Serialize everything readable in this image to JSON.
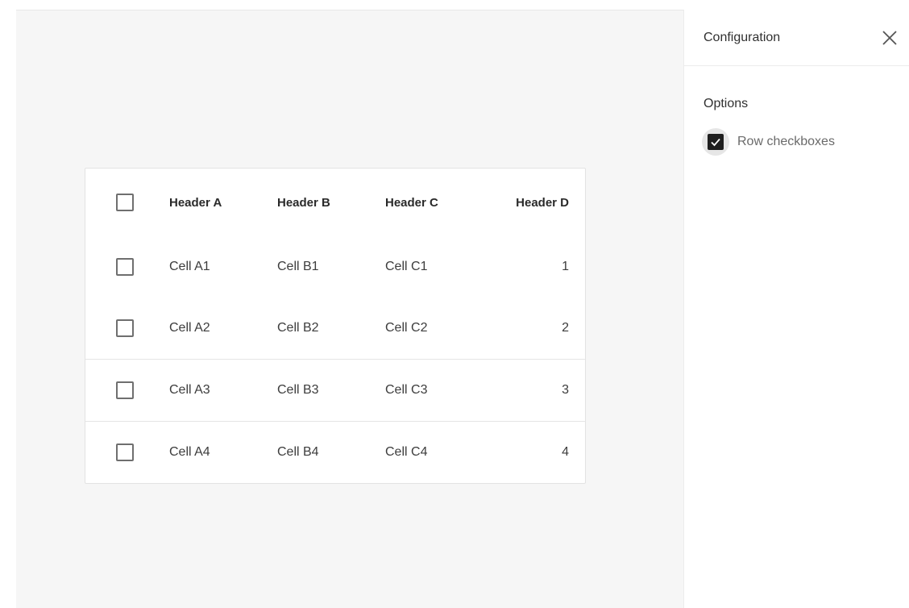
{
  "table": {
    "headers": [
      "Header A",
      "Header B",
      "Header C",
      "Header D"
    ],
    "rows": [
      {
        "a": "Cell A1",
        "b": "Cell B1",
        "c": "Cell C1",
        "d": "1"
      },
      {
        "a": "Cell A2",
        "b": "Cell B2",
        "c": "Cell C2",
        "d": "2"
      },
      {
        "a": "Cell A3",
        "b": "Cell B3",
        "c": "Cell C3",
        "d": "3"
      },
      {
        "a": "Cell A4",
        "b": "Cell B4",
        "c": "Cell C4",
        "d": "4"
      }
    ],
    "select_all_checked": false,
    "row_checked": [
      false,
      false,
      false,
      false
    ]
  },
  "panel": {
    "title": "Configuration",
    "close_icon": "close-icon",
    "section_label": "Options",
    "options": [
      {
        "label": "Row checkboxes",
        "checked": true,
        "icon": "checkmark-icon"
      }
    ]
  },
  "colors": {
    "canvas_background": "#f6f6f6",
    "checkbox_checked": "#1f1f1f",
    "checkbox_border": "#6f6f6f"
  }
}
